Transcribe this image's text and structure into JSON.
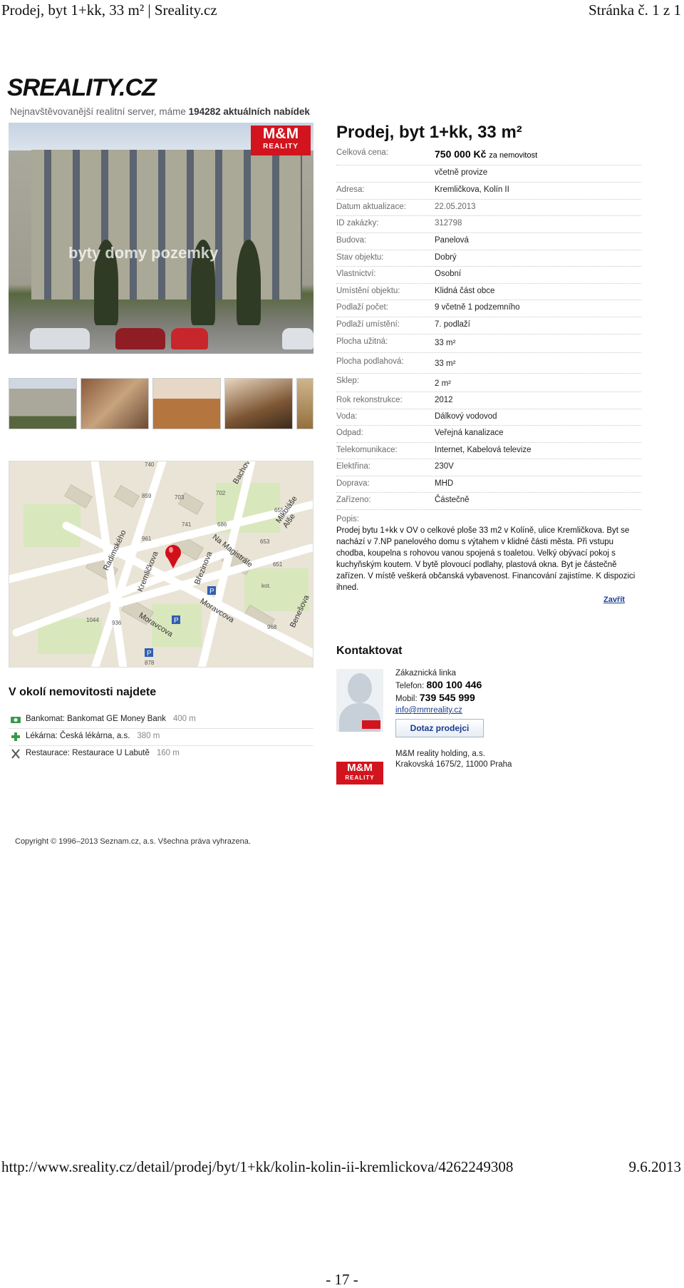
{
  "print_header": {
    "title": "Prodej, byt 1+kk, 33 m² | Sreality.cz",
    "page": "Stránka č. 1 z 1"
  },
  "site": {
    "logo": "SREALITY.CZ",
    "tagline_prefix": "Nejnavštěvovanější realitní server, máme ",
    "offers_count": "194282 aktuálních nabídek"
  },
  "listing": {
    "title": "Prodej, byt 1+kk, 33 m²",
    "photo_watermark": "byty domy pozemky",
    "agency_badge": {
      "line1": "M&M",
      "line2": "REALITY"
    },
    "price_label": "Celková cena:",
    "price_value": "750 000 Kč",
    "price_suffix": "za nemovitost",
    "price_note": "včetně provize",
    "details": [
      {
        "label": "Adresa:",
        "value": "Kremličkova, Kolín II"
      },
      {
        "label": "Datum aktualizace:",
        "value": "22.05.2013"
      },
      {
        "label": "ID zakázky:",
        "value": "312798"
      },
      {
        "label": "Budova:",
        "value": "Panelová"
      },
      {
        "label": "Stav objektu:",
        "value": "Dobrý"
      },
      {
        "label": "Vlastnictví:",
        "value": "Osobní"
      },
      {
        "label": "Umístění objektu:",
        "value": "Klidná část obce"
      },
      {
        "label": "Podlaží počet:",
        "value": "9 včetně 1 podzemního"
      },
      {
        "label": "Podlaží umístění:",
        "value": "7. podlaží"
      },
      {
        "label": "Plocha užitná:",
        "value": "33 m²"
      },
      {
        "label": "Plocha podlahová:",
        "value": "33 m²"
      },
      {
        "label": "Sklep:",
        "value": "2 m²"
      },
      {
        "label": "Rok rekonstrukce:",
        "value": "2012"
      },
      {
        "label": "Voda:",
        "value": "Dálkový vodovod"
      },
      {
        "label": "Odpad:",
        "value": "Veřejná kanalizace"
      },
      {
        "label": "Telekomunikace:",
        "value": "Internet, Kabelová televize"
      },
      {
        "label": "Elektřina:",
        "value": "230V"
      },
      {
        "label": "Doprava:",
        "value": "MHD"
      },
      {
        "label": "Zařízeno:",
        "value": "Částečně"
      }
    ],
    "description_label": "Popis:",
    "description": "Prodej bytu 1+kk v OV o celkové ploše 33 m2 v Kolíně, ulice Kremličkova. Byt se nachází v 7.NP panelového domu s výtahem v klidné části města. Při vstupu chodba, koupelna s rohovou vanou spojená s toaletou. Velký obývací pokoj s kuchyňským koutem. V bytě plovoucí podlahy, plastová okna. Byt je částečně zařízen. V místě veškerá občanská vybavenost. Financování zajistíme. K dispozici ihned.",
    "close_link": "Zavřít"
  },
  "map": {
    "streets": [
      "Radimského",
      "Kremličkova",
      "Březinova",
      "Na Magistrále",
      "Moravcova",
      "Moravcova",
      "Bachova",
      "Mikoláše Alše",
      "Benešova"
    ],
    "numbers": [
      "740",
      "859",
      "703",
      "702",
      "741",
      "686",
      "655",
      "961",
      "653",
      "651",
      "1044",
      "936",
      "968",
      "878",
      "kot."
    ]
  },
  "contact": {
    "heading": "Kontaktovat",
    "line_label": "Zákaznická linka",
    "phone_label": "Telefon:",
    "phone": "800 100 446",
    "mobile_label": "Mobil:",
    "mobile": "739 545 999",
    "email": "info@mmreality.cz",
    "button": "Dotaz prodejci",
    "company_name": "M&M reality holding, a.s.",
    "company_address": "Krakovská 1675/2, 11000 Praha",
    "logo_line1": "M&M",
    "logo_line2": "REALITY"
  },
  "nearby": {
    "heading": "V okolí nemovitosti najdete",
    "items": [
      {
        "text": "Bankomat: Bankomat GE Money Bank",
        "distance": "400 m",
        "icon": "atm-icon"
      },
      {
        "text": "Lékárna: Česká lékárna, a.s.",
        "distance": "380 m",
        "icon": "pharmacy-icon"
      },
      {
        "text": "Restaurace: Restaurace U Labutě",
        "distance": "160 m",
        "icon": "restaurant-icon"
      }
    ]
  },
  "copyright": "Copyright © 1996–2013 Seznam.cz, a.s. Všechna práva vyhrazena.",
  "print_footer": {
    "url": "http://www.sreality.cz/detail/prodej/byt/1+kk/kolin-kolin-ii-kremlickova/4262249308",
    "date": "9.6.2013",
    "page_number": "- 17 -"
  },
  "colors": {
    "brand_red": "#d1141f",
    "link_blue": "#1a3c8f",
    "label_gray": "#6b6b6b"
  }
}
